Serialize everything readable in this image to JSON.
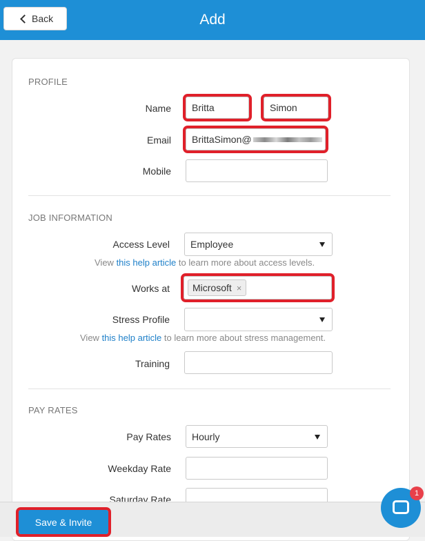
{
  "header": {
    "back_label": "Back",
    "title": "Add"
  },
  "profile": {
    "section_title": "PROFILE",
    "name_label": "Name",
    "first_name": "Britta",
    "last_name": "Simon",
    "email_label": "Email",
    "email_value": "BrittaSimon@",
    "mobile_label": "Mobile",
    "mobile_value": ""
  },
  "job": {
    "section_title": "JOB INFORMATION",
    "access_label": "Access Level",
    "access_value": "Employee",
    "access_help_prefix": "View ",
    "access_help_link": "this help article",
    "access_help_suffix": " to learn more about access levels.",
    "works_at_label": "Works at",
    "works_at_tag": "Microsoft",
    "tag_remove": "×",
    "stress_label": "Stress Profile",
    "stress_value": "",
    "stress_help_prefix": "View ",
    "stress_help_link": "this help article",
    "stress_help_suffix": " to learn more about stress management.",
    "training_label": "Training",
    "training_value": ""
  },
  "pay": {
    "section_title": "PAY RATES",
    "pay_rates_label": "Pay Rates",
    "pay_rates_value": "Hourly",
    "weekday_label": "Weekday Rate",
    "weekday_value": "",
    "saturday_label": "Saturday Rate",
    "saturday_value": ""
  },
  "footer": {
    "save_label": "Save & Invite"
  },
  "chat": {
    "badge_count": "1"
  },
  "colors": {
    "brand": "#1e8fd6",
    "highlight": "#e0202a",
    "badge": "#e8404a",
    "link": "#1f80c9"
  }
}
